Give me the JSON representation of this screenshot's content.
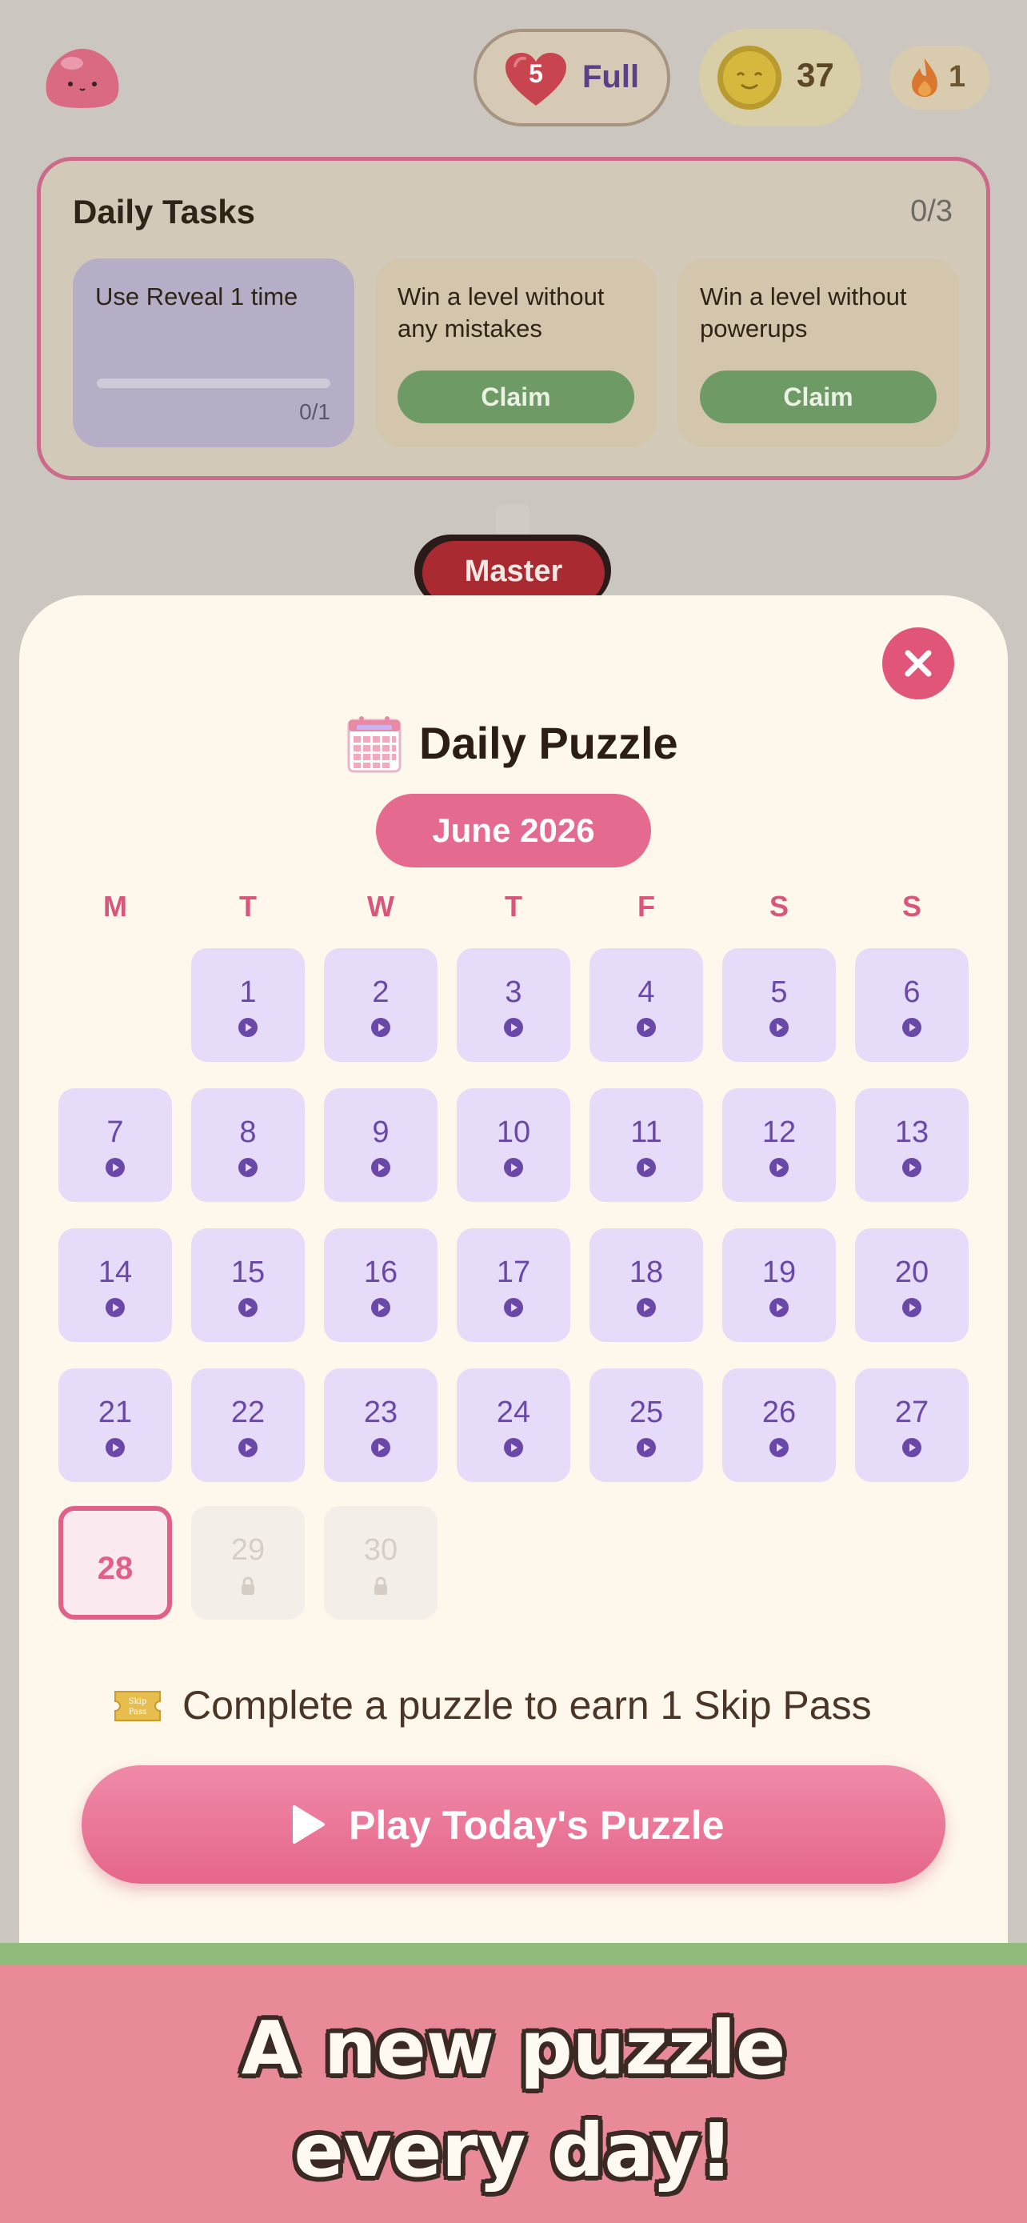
{
  "header": {
    "lives_count": "5",
    "lives_label": "Full",
    "coins": "37",
    "streak": "1"
  },
  "daily_tasks": {
    "title": "Daily Tasks",
    "count": "0/3",
    "tasks": [
      {
        "text": "Use Reveal 1 time",
        "progress": "0/1",
        "progress_fraction": 0
      },
      {
        "text": "Win a level without any mistakes",
        "button": "Claim"
      },
      {
        "text": "Win a level without powerups",
        "button": "Claim"
      }
    ]
  },
  "level_badge": "Master",
  "modal": {
    "title": "Daily Puzzle",
    "month": "June 2026",
    "weekdays": [
      "M",
      "T",
      "W",
      "T",
      "F",
      "S",
      "S"
    ],
    "days": [
      {
        "n": "1",
        "state": "playable"
      },
      {
        "n": "2",
        "state": "playable"
      },
      {
        "n": "3",
        "state": "playable"
      },
      {
        "n": "4",
        "state": "playable"
      },
      {
        "n": "5",
        "state": "playable"
      },
      {
        "n": "6",
        "state": "playable"
      },
      {
        "n": "7",
        "state": "playable"
      },
      {
        "n": "8",
        "state": "playable"
      },
      {
        "n": "9",
        "state": "playable"
      },
      {
        "n": "10",
        "state": "playable"
      },
      {
        "n": "11",
        "state": "playable"
      },
      {
        "n": "12",
        "state": "playable"
      },
      {
        "n": "13",
        "state": "playable"
      },
      {
        "n": "14",
        "state": "playable"
      },
      {
        "n": "15",
        "state": "playable"
      },
      {
        "n": "16",
        "state": "playable"
      },
      {
        "n": "17",
        "state": "playable"
      },
      {
        "n": "18",
        "state": "playable"
      },
      {
        "n": "19",
        "state": "playable"
      },
      {
        "n": "20",
        "state": "playable"
      },
      {
        "n": "21",
        "state": "playable"
      },
      {
        "n": "22",
        "state": "playable"
      },
      {
        "n": "23",
        "state": "playable"
      },
      {
        "n": "24",
        "state": "playable"
      },
      {
        "n": "25",
        "state": "playable"
      },
      {
        "n": "26",
        "state": "playable"
      },
      {
        "n": "27",
        "state": "playable"
      },
      {
        "n": "28",
        "state": "today"
      },
      {
        "n": "29",
        "state": "locked"
      },
      {
        "n": "30",
        "state": "locked"
      }
    ],
    "ticket_text": "Skip Pass",
    "earn_text": "Complete a puzzle to earn 1 Skip Pass",
    "play_button": "Play Today's Puzzle"
  },
  "promo": {
    "line1": "A new puzzle",
    "line2": "every day!"
  },
  "colors": {
    "accent_pink": "#e56a8f",
    "day_bg": "#e7dbfa",
    "day_text": "#6a48a8",
    "claim_green": "#6e9a66"
  },
  "icons": [
    "slime-avatar-icon",
    "heart-icon",
    "coin-icon",
    "flame-icon",
    "close-icon",
    "calendar-icon",
    "play-icon",
    "lock-icon",
    "skip-pass-ticket-icon"
  ]
}
